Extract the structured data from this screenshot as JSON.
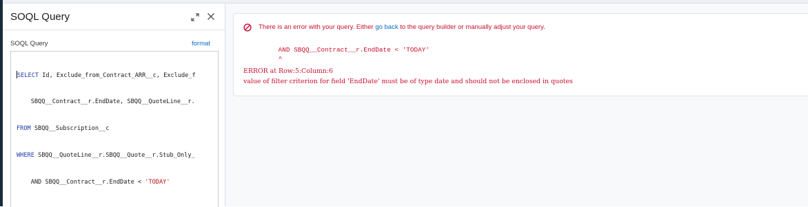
{
  "panel": {
    "title": "SOQL Query",
    "editor_label": "SOQL Query",
    "format_label": "format",
    "query_lines": [
      {
        "keyword": "SELECT",
        "text": " Id, Exclude_from_Contract_ARR__c, Exclude_f"
      },
      {
        "keyword": "",
        "text": "    SBQQ__Contract__r.EndDate, SBQQ__QuoteLine__r."
      },
      {
        "keyword": "FROM",
        "text": " SBQQ__Subscription__c"
      },
      {
        "keyword": "WHERE",
        "text": " SBQQ__QuoteLine__r.SBQQ__Quote__r.Stub_Only_"
      },
      {
        "keyword": "",
        "text": "    AND SBQQ__Contract__r.EndDate < ",
        "string": "'TODAY'"
      }
    ]
  },
  "error": {
    "message_before": "There is an error with your query. Either ",
    "link": "go back",
    "message_after": " to the query builder or manually adjust your query.",
    "code_line": "         AND SBQQ__Contract__r.EndDate < 'TODAY'",
    "caret_line": "         ^",
    "location": "ERROR at Row:5:Column:6",
    "detail": "value of filter criterion for field 'EndDate' must be of type date and should not be enclosed in quotes"
  },
  "colors": {
    "error": "#c8102e",
    "link": "#0b6bcb",
    "keyword": "#1f3bb3"
  }
}
